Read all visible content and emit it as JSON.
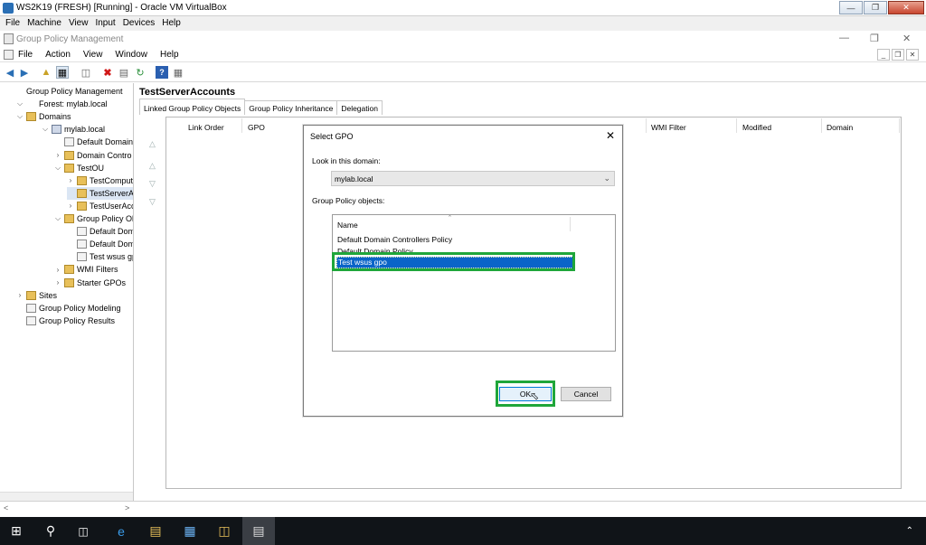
{
  "vbox": {
    "title": "WS2K19 (FRESH) [Running] - Oracle VM VirtualBox",
    "menu": [
      "File",
      "Machine",
      "View",
      "Input",
      "Devices",
      "Help"
    ]
  },
  "gpm": {
    "title": "Group Policy Management",
    "menu": [
      "File",
      "Action",
      "View",
      "Window",
      "Help"
    ]
  },
  "tree": [
    {
      "label": "Group Policy Management",
      "indent": 0,
      "icon": "gpm",
      "exp": ""
    },
    {
      "label": "Forest: mylab.local",
      "indent": 1,
      "icon": "forest",
      "exp": "v"
    },
    {
      "label": "Domains",
      "indent": 2,
      "icon": "folder",
      "exp": "v"
    },
    {
      "label": "mylab.local",
      "indent": 3,
      "icon": "dom",
      "exp": "v"
    },
    {
      "label": "Default Domain",
      "indent": 4,
      "icon": "gpo",
      "exp": ""
    },
    {
      "label": "Domain Contro",
      "indent": 4,
      "icon": "ou",
      "exp": ">"
    },
    {
      "label": "TestOU",
      "indent": 4,
      "icon": "ou",
      "exp": "v"
    },
    {
      "label": "TestComput",
      "indent": 5,
      "icon": "ou",
      "exp": ">"
    },
    {
      "label": "TestServerAc",
      "indent": 5,
      "icon": "ou",
      "exp": "",
      "selected": true
    },
    {
      "label": "TestUserAcc",
      "indent": 5,
      "icon": "ou",
      "exp": ">"
    },
    {
      "label": "Group Policy Ol",
      "indent": 4,
      "icon": "folder",
      "exp": "v"
    },
    {
      "label": "Default Dom",
      "indent": 5,
      "icon": "gpo",
      "exp": ""
    },
    {
      "label": "Default Dom",
      "indent": 5,
      "icon": "gpo",
      "exp": ""
    },
    {
      "label": "Test wsus gp",
      "indent": 5,
      "icon": "gpo",
      "exp": ""
    },
    {
      "label": "WMI Filters",
      "indent": 4,
      "icon": "folder",
      "exp": ">"
    },
    {
      "label": "Starter GPOs",
      "indent": 4,
      "icon": "folder",
      "exp": ">"
    },
    {
      "label": "Sites",
      "indent": 1,
      "icon": "folder",
      "exp": ">"
    },
    {
      "label": "Group Policy Modeling",
      "indent": 1,
      "icon": "gpo",
      "exp": ""
    },
    {
      "label": "Group Policy Results",
      "indent": 1,
      "icon": "gpo",
      "exp": ""
    }
  ],
  "right": {
    "heading": "TestServerAccounts",
    "tabs": [
      "Linked Group Policy Objects",
      "Group Policy Inheritance",
      "Delegation"
    ],
    "columns": [
      "Link Order",
      "GPO",
      "WMI Filter",
      "Modified",
      "Domain"
    ]
  },
  "dialog": {
    "title": "Select GPO",
    "close": "✕",
    "look_in_label": "Look in this domain:",
    "domain_value": "mylab.local",
    "objects_label": "Group Policy objects:",
    "name_header": "Name",
    "items": [
      "Default Domain Controllers Policy",
      "Default Domain Policy",
      "Test wsus gpo"
    ],
    "ok": "OK",
    "cancel": "Cancel"
  },
  "colors": {
    "highlight": "#1fa63a",
    "selection": "#0a64c8"
  }
}
